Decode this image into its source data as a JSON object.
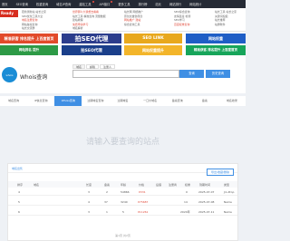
{
  "nav": {
    "items": [
      "首页",
      "SEO查询",
      "权重查询",
      "域名IP查询",
      "建站工具",
      "API接口",
      "更多工具",
      "排行榜",
      "站长",
      "网站排行",
      "网站统计"
    ]
  },
  "links": {
    "badge": "Ready",
    "col1": [
      "若检测新站 站长之家",
      "SEO优化工具大全",
      "域名注册查询",
      "网站备案查询",
      "站长交流群"
    ],
    "col2": [
      "世界那么大我想去看看",
      "站长工具 精准查询 流量数据",
      "建站教程",
      "免费申请学习",
      "域名解析",
      "域名认证"
    ],
    "col3": [
      "站长网 网络推广",
      "原创文章伪原创",
      "网站推广 建站",
      "综合查询工具"
    ],
    "col4": [
      "SEO综合查询",
      "友情链接 检测",
      "SEO学习",
      "百度权重查询"
    ],
    "col5": [
      "站长工具 站长之家",
      "关键词挖掘",
      "站长推荐",
      "站群软件"
    ]
  },
  "ads": {
    "ad1": "拍SEO代理",
    "ad2": "SEO LINK",
    "ad3": "网站权重",
    "ad4": "网站排名 提升",
    "ad5": "精准获客 排名提升 上百度首页",
    "ad6": "网站权重提升"
  },
  "whois": {
    "logo_text": "whois",
    "title": "Whois查询",
    "tabs": [
      "域名",
      "邮箱",
      "注册人"
    ],
    "query_btn": "查询",
    "history_btn": "历史查询"
  },
  "tools": {
    "items": [
      "域名查询",
      "IP信息查询",
      "Whois查询",
      "过期域名查询",
      "过期域名",
      "一口价域名",
      "备案查询",
      "备案",
      "域名收录"
    ],
    "active_index": 2
  },
  "hint": "请输入要查询的站点",
  "panel": {
    "tab_label": "域名出售",
    "export_label": "导出/收藏/删除",
    "headers": [
      "排序",
      "域名",
      "长度",
      "备案",
      "年龄",
      "价格",
      "后缀",
      "注册商",
      "权重",
      "到期时间",
      "类型",
      "类型"
    ],
    "rows": [
      {
        "idx": "4",
        "domain": "",
        "len": "3",
        "beian": "2",
        "age": "54866",
        "price": "¥331",
        "ext": "",
        "tag": "",
        "stat": "0",
        "date": "2025-07-07",
        "type": "Jin-Prop"
      },
      {
        "idx": "5",
        "domain": "",
        "len": "4",
        "beian": "37",
        "age": "3240",
        "price": "¥75687",
        "ext": "",
        "tag": "",
        "stat": "14",
        "date": "2025-07-08",
        "type": "Name"
      },
      {
        "idx": "6",
        "domain": "",
        "len": "3",
        "beian": "1",
        "age": "5",
        "price": "¥11261",
        "ext": "",
        "tag": "",
        "stat": "2024年",
        "date": "2025-07-11",
        "type": "Name"
      }
    ],
    "pager": "第1页 共2页"
  }
}
